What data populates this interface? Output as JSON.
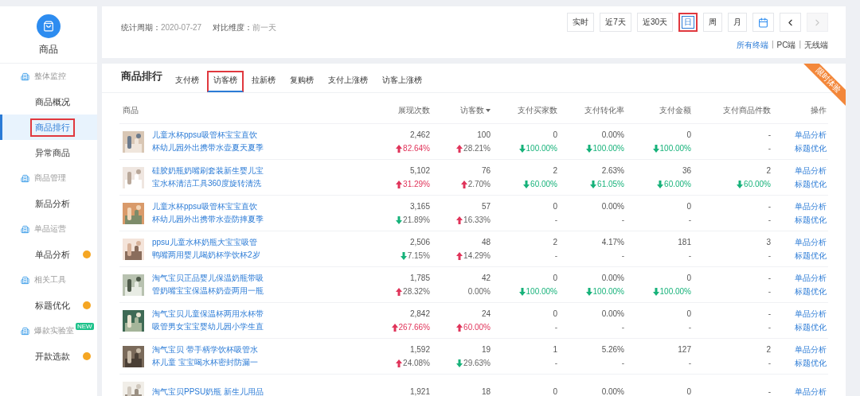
{
  "sidebar": {
    "title": "商品",
    "items": [
      {
        "kind": "section",
        "label": "整体监控"
      },
      {
        "kind": "link",
        "label": "商品概况",
        "selected": false,
        "highlighted": false,
        "dot": false
      },
      {
        "kind": "link",
        "label": "商品排行",
        "selected": true,
        "highlighted": true,
        "dot": false
      },
      {
        "kind": "link",
        "label": "异常商品",
        "selected": false,
        "highlighted": false,
        "dot": false
      },
      {
        "kind": "section",
        "label": "商品管理"
      },
      {
        "kind": "link",
        "label": "新品分析",
        "selected": false,
        "highlighted": false,
        "dot": false
      },
      {
        "kind": "section",
        "label": "单品运营"
      },
      {
        "kind": "link",
        "label": "单品分析",
        "selected": false,
        "highlighted": false,
        "dot": true
      },
      {
        "kind": "section",
        "label": "相关工具"
      },
      {
        "kind": "link",
        "label": "标题优化",
        "selected": false,
        "highlighted": false,
        "dot": true
      },
      {
        "kind": "section",
        "label": "爆款实验室",
        "badge": "NEW"
      },
      {
        "kind": "link",
        "label": "开款选款",
        "selected": false,
        "highlighted": false,
        "dot": true
      }
    ]
  },
  "filters": {
    "period_label": "统计周期：",
    "period": "2020-07-27",
    "compare_label": "对比维度：",
    "compare": "前一天",
    "ranges": [
      {
        "kind": "text",
        "label": "实时",
        "selected": false,
        "highlighted": false,
        "disabled": false
      },
      {
        "kind": "text",
        "label": "近7天",
        "selected": false,
        "highlighted": false,
        "disabled": false
      },
      {
        "kind": "text",
        "label": "近30天",
        "selected": false,
        "highlighted": false,
        "disabled": false
      },
      {
        "kind": "text",
        "label": "日",
        "selected": true,
        "highlighted": true,
        "disabled": false
      },
      {
        "kind": "text",
        "label": "周",
        "selected": false,
        "highlighted": false,
        "disabled": false
      },
      {
        "kind": "text",
        "label": "月",
        "selected": false,
        "highlighted": false,
        "disabled": false
      },
      {
        "kind": "calendar",
        "selected": false,
        "highlighted": false,
        "disabled": false
      },
      {
        "kind": "prev",
        "selected": false,
        "highlighted": false,
        "disabled": false
      },
      {
        "kind": "next",
        "selected": false,
        "highlighted": false,
        "disabled": true
      }
    ],
    "terminals": [
      {
        "kind": "link",
        "label": "所有终端",
        "selected": true
      },
      {
        "kind": "separator",
        "label": "|"
      },
      {
        "kind": "link",
        "label": "PC端",
        "selected": false
      },
      {
        "kind": "separator",
        "label": "|"
      },
      {
        "kind": "link",
        "label": "无线端",
        "selected": false
      }
    ]
  },
  "ranking": {
    "title": "商品排行",
    "ribbon": "限时体验",
    "tabs": [
      {
        "label": "支付榜",
        "selected": false,
        "highlighted": false
      },
      {
        "label": "访客榜",
        "selected": true,
        "highlighted": true
      },
      {
        "label": "拉新榜",
        "selected": false,
        "highlighted": false
      },
      {
        "label": "复购榜",
        "selected": false,
        "highlighted": false
      },
      {
        "label": "支付上涨榜",
        "selected": false,
        "highlighted": false
      },
      {
        "label": "访客上涨榜",
        "selected": false,
        "highlighted": false
      }
    ],
    "columns": [
      {
        "label": "商品",
        "sorted": false
      },
      {
        "label": "展现次数",
        "sorted": false
      },
      {
        "label": "访客数",
        "sorted": true
      },
      {
        "label": "支付买家数",
        "sorted": false
      },
      {
        "label": "支付转化率",
        "sorted": false
      },
      {
        "label": "支付金额",
        "sorted": false
      },
      {
        "label": "支付商品件数",
        "sorted": false
      },
      {
        "label": "操作",
        "sorted": false
      }
    ],
    "rows": [
      {
        "title_lines": [
          "儿童水杯ppsu吸管杯宝宝直饮",
          "杯幼儿园外出携带水壶夏天夏季"
        ],
        "metrics": [
          {
            "value": "2,462",
            "change": {
              "kind": "up",
              "text": "82.64%",
              "tinted": true
            }
          },
          {
            "value": "100",
            "change": {
              "kind": "up",
              "text": "28.21%",
              "tinted": false
            }
          },
          {
            "value": "0",
            "change": {
              "kind": "down",
              "text": "100.00%",
              "tinted": true
            }
          },
          {
            "value": "0.00%",
            "change": {
              "kind": "down",
              "text": "100.00%",
              "tinted": true
            }
          },
          {
            "value": "0",
            "change": {
              "kind": "down",
              "text": "100.00%",
              "tinted": true
            }
          },
          {
            "value": "-",
            "change": {
              "kind": "plain",
              "text": "-",
              "tinted": false
            }
          }
        ],
        "actions": [
          "单品分析",
          "标题优化"
        ]
      },
      {
        "title_lines": [
          "硅胶奶瓶奶嘴刷套装新生婴儿宝",
          "宝水杯清洁工具360度旋转清洗"
        ],
        "metrics": [
          {
            "value": "5,102",
            "change": {
              "kind": "up",
              "text": "31.29%",
              "tinted": true
            }
          },
          {
            "value": "76",
            "change": {
              "kind": "up",
              "text": "2.70%",
              "tinted": false
            }
          },
          {
            "value": "2",
            "change": {
              "kind": "down",
              "text": "60.00%",
              "tinted": true
            }
          },
          {
            "value": "2.63%",
            "change": {
              "kind": "down",
              "text": "61.05%",
              "tinted": true
            }
          },
          {
            "value": "36",
            "change": {
              "kind": "down",
              "text": "60.00%",
              "tinted": true
            }
          },
          {
            "value": "2",
            "change": {
              "kind": "down",
              "text": "60.00%",
              "tinted": true
            }
          }
        ],
        "actions": [
          "单品分析",
          "标题优化"
        ]
      },
      {
        "title_lines": [
          "儿童水杯ppsu吸管杯宝宝直饮",
          "杯幼儿园外出携带水壶防摔夏季"
        ],
        "metrics": [
          {
            "value": "3,165",
            "change": {
              "kind": "down",
              "text": "21.89%",
              "tinted": false
            }
          },
          {
            "value": "57",
            "change": {
              "kind": "up",
              "text": "16.33%",
              "tinted": false
            }
          },
          {
            "value": "0",
            "change": {
              "kind": "plain",
              "text": "-",
              "tinted": false
            }
          },
          {
            "value": "0.00%",
            "change": {
              "kind": "plain",
              "text": "-",
              "tinted": false
            }
          },
          {
            "value": "0",
            "change": {
              "kind": "plain",
              "text": "-",
              "tinted": false
            }
          },
          {
            "value": "-",
            "change": {
              "kind": "plain",
              "text": "-",
              "tinted": false
            }
          }
        ],
        "actions": [
          "单品分析",
          "标题优化"
        ]
      },
      {
        "title_lines": [
          "ppsu儿童水杯奶瓶大宝宝吸管",
          "鸭嘴两用婴儿喝奶杯学饮杯2岁"
        ],
        "metrics": [
          {
            "value": "2,506",
            "change": {
              "kind": "down",
              "text": "7.15%",
              "tinted": false
            }
          },
          {
            "value": "48",
            "change": {
              "kind": "up",
              "text": "14.29%",
              "tinted": false
            }
          },
          {
            "value": "2",
            "change": {
              "kind": "plain",
              "text": "-",
              "tinted": false
            }
          },
          {
            "value": "4.17%",
            "change": {
              "kind": "plain",
              "text": "-",
              "tinted": false
            }
          },
          {
            "value": "181",
            "change": {
              "kind": "plain",
              "text": "-",
              "tinted": false
            }
          },
          {
            "value": "3",
            "change": {
              "kind": "plain",
              "text": "-",
              "tinted": false
            }
          }
        ],
        "actions": [
          "单品分析",
          "标题优化"
        ]
      },
      {
        "title_lines": [
          "淘气宝贝正品婴儿保温奶瓶带吸",
          "管奶嘴宝宝保温杯奶壶两用一瓶"
        ],
        "metrics": [
          {
            "value": "1,785",
            "change": {
              "kind": "up",
              "text": "28.32%",
              "tinted": false
            }
          },
          {
            "value": "42",
            "change": {
              "kind": "plain",
              "text": "0.00%",
              "tinted": false
            }
          },
          {
            "value": "0",
            "change": {
              "kind": "down",
              "text": "100.00%",
              "tinted": true
            }
          },
          {
            "value": "0.00%",
            "change": {
              "kind": "down",
              "text": "100.00%",
              "tinted": true
            }
          },
          {
            "value": "0",
            "change": {
              "kind": "down",
              "text": "100.00%",
              "tinted": true
            }
          },
          {
            "value": "-",
            "change": {
              "kind": "plain",
              "text": "-",
              "tinted": false
            }
          }
        ],
        "actions": [
          "单品分析",
          "标题优化"
        ]
      },
      {
        "title_lines": [
          "淘气宝贝儿童保温杯两用水杯带",
          "吸管男女宝宝婴幼儿园小学生直"
        ],
        "metrics": [
          {
            "value": "2,842",
            "change": {
              "kind": "up",
              "text": "267.66%",
              "tinted": true
            }
          },
          {
            "value": "24",
            "change": {
              "kind": "up",
              "text": "60.00%",
              "tinted": true
            }
          },
          {
            "value": "0",
            "change": {
              "kind": "plain",
              "text": "-",
              "tinted": false
            }
          },
          {
            "value": "0.00%",
            "change": {
              "kind": "plain",
              "text": "-",
              "tinted": false
            }
          },
          {
            "value": "0",
            "change": {
              "kind": "plain",
              "text": "-",
              "tinted": false
            }
          },
          {
            "value": "-",
            "change": {
              "kind": "plain",
              "text": "-",
              "tinted": false
            }
          }
        ],
        "actions": [
          "单品分析",
          "标题优化"
        ]
      },
      {
        "title_lines": [
          "淘气宝贝 带手柄学饮杯吸管水",
          "杯儿童 宝宝喝水杯密封防漏一"
        ],
        "metrics": [
          {
            "value": "1,592",
            "change": {
              "kind": "up",
              "text": "24.08%",
              "tinted": false
            }
          },
          {
            "value": "19",
            "change": {
              "kind": "down",
              "text": "29.63%",
              "tinted": false
            }
          },
          {
            "value": "1",
            "change": {
              "kind": "plain",
              "text": "-",
              "tinted": false
            }
          },
          {
            "value": "5.26%",
            "change": {
              "kind": "plain",
              "text": "-",
              "tinted": false
            }
          },
          {
            "value": "127",
            "change": {
              "kind": "plain",
              "text": "-",
              "tinted": false
            }
          },
          {
            "value": "2",
            "change": {
              "kind": "plain",
              "text": "-",
              "tinted": false
            }
          }
        ],
        "actions": [
          "单品分析",
          "标题优化"
        ]
      },
      {
        "title_lines": [
          "淘气宝贝PPSU奶瓶 新生儿用品"
        ],
        "metrics": [
          {
            "value": "1,921"
          },
          {
            "value": "18"
          },
          {
            "value": "0"
          },
          {
            "value": "0.00%"
          },
          {
            "value": "0"
          },
          {
            "value": "-"
          }
        ],
        "actions": [
          "单品分析"
        ]
      }
    ]
  }
}
